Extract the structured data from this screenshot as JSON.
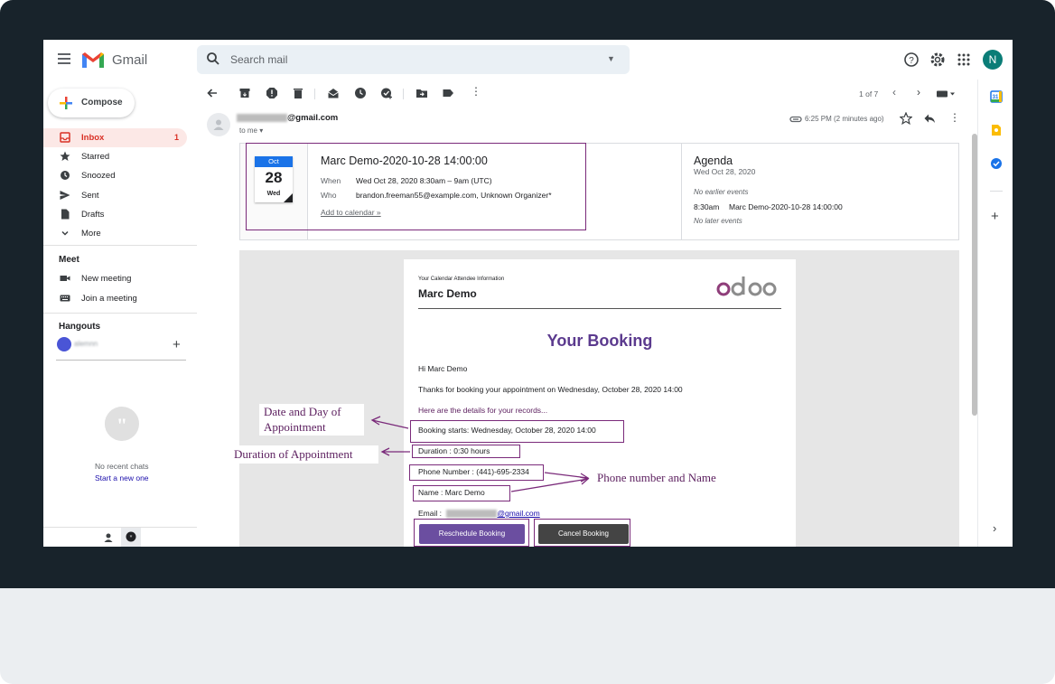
{
  "app": {
    "name": "Gmail"
  },
  "search": {
    "placeholder": "Search mail"
  },
  "header": {
    "avatar_initial": "N"
  },
  "sidebar": {
    "compose_label": "Compose",
    "items": [
      {
        "label": "Inbox",
        "count": "1"
      },
      {
        "label": "Starred"
      },
      {
        "label": "Snoozed"
      },
      {
        "label": "Sent"
      },
      {
        "label": "Drafts"
      },
      {
        "label": "More"
      }
    ],
    "meet": {
      "title": "Meet",
      "items": [
        {
          "label": "New meeting"
        },
        {
          "label": "Join a meeting"
        }
      ]
    },
    "hangouts": {
      "title": "Hangouts",
      "user_blurred": "alemnn"
    },
    "chat": {
      "no_recent": "No recent chats",
      "start_new": "Start a new one"
    }
  },
  "toolbar": {
    "count": "1 of 7"
  },
  "email": {
    "sender": "@gmail.com",
    "to": "to me",
    "time": "6:25 PM (2 minutes ago)"
  },
  "invite": {
    "month": "Oct",
    "day": "28",
    "dow": "Wed",
    "title": "Marc Demo-2020-10-28 14:00:00",
    "when_label": "When",
    "when_value": "Wed Oct 28, 2020 8:30am – 9am (UTC)",
    "who_label": "Who",
    "who_value": "brandon.freeman55@example.com, Unknown Organizer*",
    "add_calendar": "Add to calendar »"
  },
  "agenda": {
    "title": "Agenda",
    "date": "Wed Oct 28, 2020",
    "no_earlier": "No earlier events",
    "event_time": "8:30am",
    "event_title": "Marc Demo-2020-10-28 14:00:00",
    "no_later": "No later events"
  },
  "body": {
    "caption": "Your Calendar Attendee Information",
    "name": "Marc Demo",
    "logo": "odoo",
    "booking_title": "Your Booking",
    "greeting": "Hi Marc Demo",
    "thanks": "Thanks for booking your appointment on Wednesday, October 28, 2020 14:00",
    "details": "Here are the details for your records...",
    "starts": "Booking starts: Wednesday, October 28, 2020 14:00",
    "duration": "Duration : 0:30 hours",
    "phone": "Phone Number : (441)-695-2334",
    "name_line": "Name : Marc Demo",
    "email_label": "Email :",
    "email_value": "@gmail.com",
    "reschedule": "Reschedule Booking",
    "cancel": "Cancel Booking"
  },
  "annotations": {
    "date_day_1": "Date and Day of",
    "date_day_2": "Appointment",
    "duration": "Duration of Appointment",
    "phone_name": "Phone number and Name"
  },
  "colors": {
    "brand_purple": "#5b3a8e",
    "annotation": "#7a2a7a",
    "inbox_red": "#d93025"
  }
}
